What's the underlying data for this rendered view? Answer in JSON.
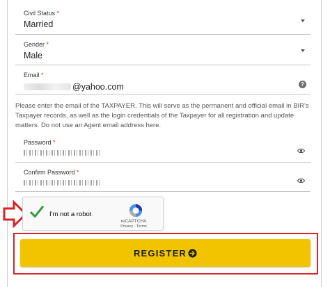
{
  "form": {
    "civil_status": {
      "label": "Civil Status",
      "required": "*",
      "value": "Married"
    },
    "gender": {
      "label": "Gender",
      "required": "*",
      "value": "Male"
    },
    "email": {
      "label": "Email",
      "required": "*",
      "value": "@yahoo.com"
    },
    "email_note": "Please enter the email of the TAXPAYER. This will serve as the permanent and official email in BIR's Taxpayer records, as well as the login credentials of the Taxpayer for all registration and update matters. Do not use an Agent email address here.",
    "password": {
      "label": "Password",
      "required": "*"
    },
    "confirm_password": {
      "label": "Confirm Password",
      "required": "*"
    }
  },
  "captcha": {
    "label": "I'm not a robot",
    "brand": "reCAPTCHA",
    "links": "Privacy - Terms"
  },
  "register": {
    "label": "REGISTER"
  },
  "colors": {
    "button": "#f2c400",
    "highlight": "#d9232a",
    "check": "#2e9b3a",
    "required": "#d93025"
  },
  "icons": [
    "chevron-down-icon",
    "help-icon",
    "eye-icon",
    "checkmark-icon",
    "recaptcha-logo-icon",
    "arrow-right-circle-icon",
    "red-arrow-icon"
  ]
}
